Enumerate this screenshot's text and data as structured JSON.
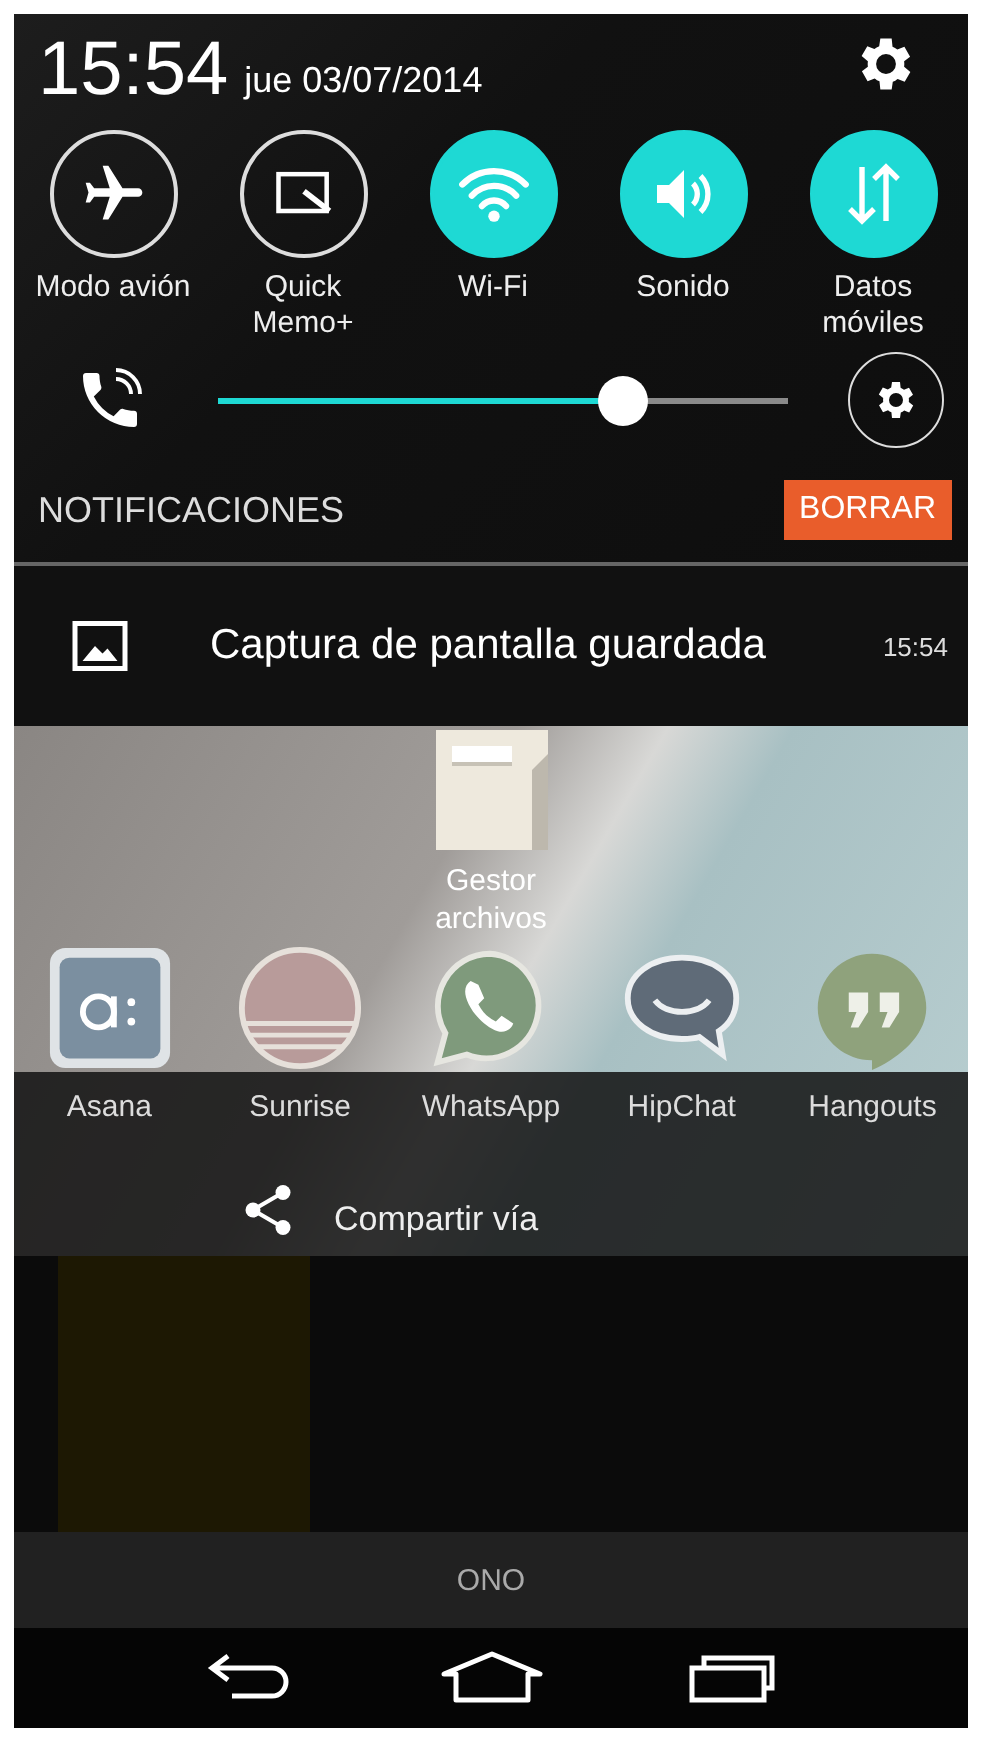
{
  "status": {
    "time": "15:54",
    "date": "jue 03/07/2014"
  },
  "toggles": [
    {
      "label": "Modo avión",
      "on": false
    },
    {
      "label": "Quick Memo+",
      "on": false
    },
    {
      "label": "Wi-Fi",
      "on": true
    },
    {
      "label": "Sonido",
      "on": true
    },
    {
      "label": "Datos móviles",
      "on": true
    }
  ],
  "brightness": {
    "level": 0.71
  },
  "notifications": {
    "title": "NOTIFICACIONES",
    "clear_button": "BORRAR",
    "items": [
      {
        "title": "Captura de pantalla guardada",
        "time": "15:54"
      }
    ]
  },
  "home_screen": {
    "file_manager_label": "Gestor archivos"
  },
  "share": {
    "apps": [
      {
        "label": "Asana"
      },
      {
        "label": "Sunrise"
      },
      {
        "label": "WhatsApp"
      },
      {
        "label": "HipChat"
      },
      {
        "label": "Hangouts"
      }
    ],
    "label": "Compartir vía"
  },
  "carrier": "ONO"
}
